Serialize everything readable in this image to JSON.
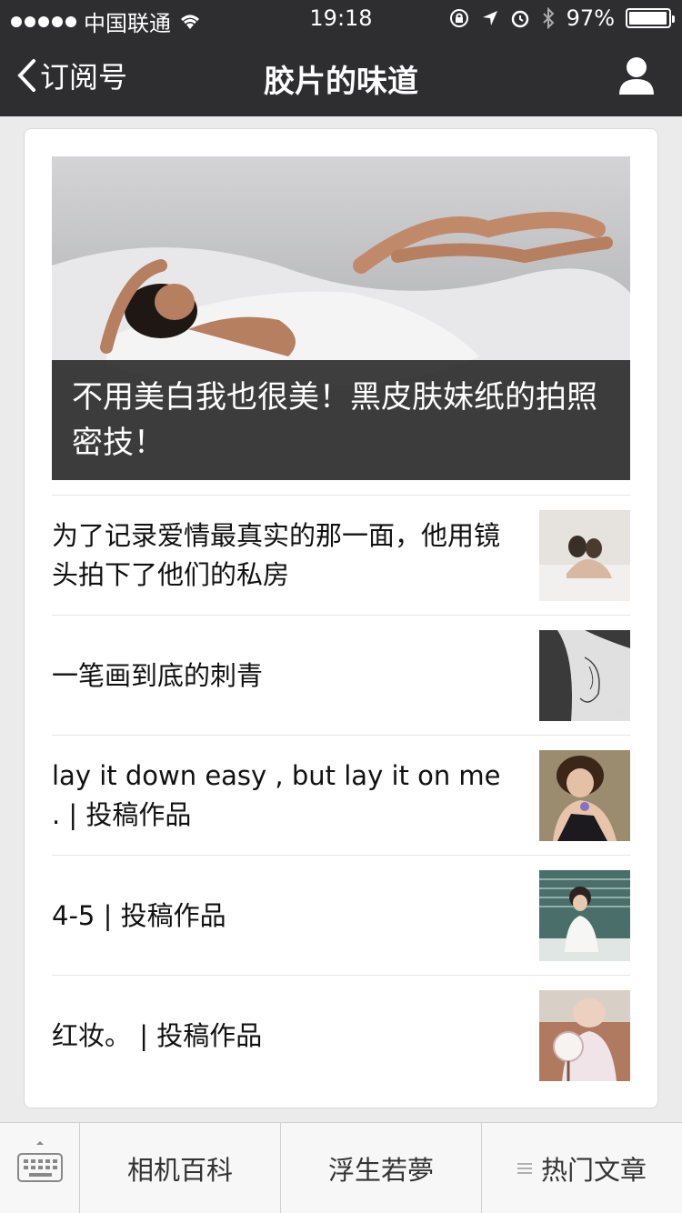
{
  "status_bar": {
    "carrier": "中国联通",
    "time": "19:18",
    "battery": "97%",
    "battery_level": 0.97
  },
  "nav": {
    "back_label": "订阅号",
    "title": "胶片的味道"
  },
  "hero": {
    "caption": "不用美白我也很美！黑皮肤妹纸的拍照密技！"
  },
  "articles": [
    {
      "title": "为了记录爱情最真实的那一面，他用镜头拍下了他们的私房"
    },
    {
      "title": "一笔画到底的刺青"
    },
    {
      "title": "lay it down easy , but lay it on me . | 投稿作品"
    },
    {
      "title": "4-5 | 投稿作品"
    },
    {
      "title": "红妆。 | 投稿作品"
    }
  ],
  "bottom_menu": {
    "items": [
      "相机百科",
      "浮生若夢",
      "热门文章"
    ]
  },
  "colors": {
    "nav_bg": "#2e2e30",
    "page_bg": "#ebebeb",
    "card_bg": "#ffffff"
  }
}
